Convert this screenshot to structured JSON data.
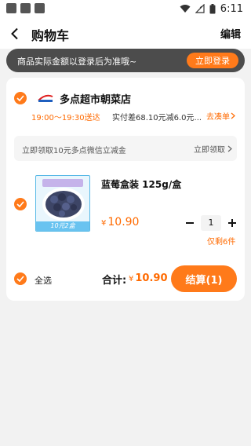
{
  "status_bar": {
    "time": "6:11",
    "icons": [
      "wifi-icon",
      "signal-icon",
      "battery-icon"
    ]
  },
  "header": {
    "title": "购物车",
    "edit_label": "编辑"
  },
  "login_banner": {
    "text": "商品实际金额以登录后为准哦~",
    "button": "立即登录"
  },
  "store": {
    "name": "多点超市朝菜店",
    "delivery_time": "19:00～19:30送达",
    "delivery_note": "实付差68.10元减6.0元...",
    "add_more": "去凑单"
  },
  "coupon": {
    "text": "立即领取10元多点微信立减金",
    "link": "立即领取"
  },
  "product": {
    "name": "蓝莓盒装 125g/盒",
    "currency": "¥",
    "price": "10.90",
    "quantity": "1",
    "stock": "仅剩6件",
    "image_label": "10元2盒"
  },
  "footer": {
    "select_all": "全选",
    "total_label": "合计:",
    "currency": "¥",
    "total": "10.90",
    "checkout": "结算(1)"
  },
  "colors": {
    "accent": "#ff7a1a",
    "price": "#ff6a00",
    "banner_bg": "#4c4c4c",
    "page_bg": "#f2f2f2"
  }
}
